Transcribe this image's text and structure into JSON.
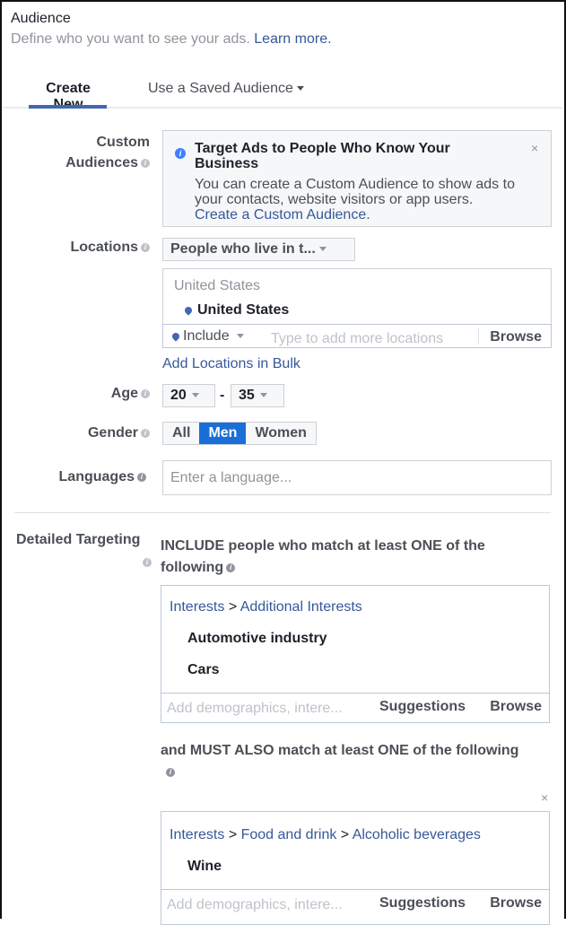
{
  "header": {
    "title": "Audience",
    "subtitle": "Define who you want to see your ads.",
    "learn_more": "Learn more."
  },
  "tabs": [
    {
      "label": "Create New",
      "active": true
    },
    {
      "label": "Use a Saved Audience",
      "active": false
    }
  ],
  "custom_audiences": {
    "label_line1": "Custom",
    "label_line2": "Audiences",
    "notice_title": "Target Ads to People Who Know Your Business",
    "notice_body": "You can create a Custom Audience to show ads to your contacts, website visitors or app users.",
    "notice_link": "Create a Custom Audience",
    "notice_link_suffix": ".",
    "close": "×"
  },
  "locations": {
    "label": "Locations",
    "type_select": "People who live in t...",
    "region_header": "United States",
    "selected": [
      "United States"
    ],
    "include_select": "Include",
    "input_placeholder": "Type to add more locations",
    "browse": "Browse",
    "bulk_link": "Add Locations in Bulk"
  },
  "age": {
    "label": "Age",
    "min": "20",
    "separator": "-",
    "max": "35"
  },
  "gender": {
    "label": "Gender",
    "options": [
      "All",
      "Men",
      "Women"
    ],
    "selected": "Men"
  },
  "languages": {
    "label": "Languages",
    "placeholder": "Enter a language..."
  },
  "detailed_targeting": {
    "label": "Detailed Targeting",
    "include_heading_line1": "INCLUDE people who match at least ONE of the",
    "include_heading_line2": "following",
    "include_group": {
      "crumbs": [
        "Interests",
        "Additional Interests"
      ],
      "items": [
        "Automotive industry",
        "Cars"
      ]
    },
    "must_heading": "and MUST ALSO match at least ONE of the following",
    "must_group": {
      "crumbs": [
        "Interests",
        "Food and drink",
        "Alcoholic beverages"
      ],
      "items": [
        "Wine"
      ]
    },
    "crumb_separator": ">",
    "input_placeholder": "Add demographics, intere...",
    "suggestions": "Suggestions",
    "browse": "Browse",
    "close": "×"
  },
  "colors": {
    "accent": "#4267b2",
    "link": "#365899",
    "selected_button": "#1a6ed8",
    "info_blue": "#4080ff"
  }
}
